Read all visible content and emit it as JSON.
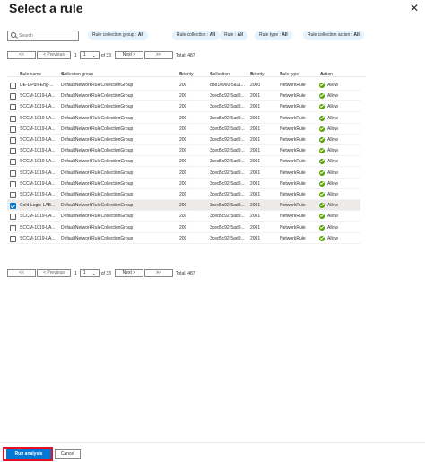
{
  "panel": {
    "title": "Select a rule"
  },
  "search": {
    "placeholder": "Search",
    "value": ""
  },
  "filters": [
    {
      "label": "Rule collection group : ",
      "value": "All"
    },
    {
      "label": "Rule collection : ",
      "value": "All"
    },
    {
      "label": "Rule : ",
      "value": "All"
    },
    {
      "label": "Rule type : ",
      "value": "All"
    },
    {
      "label": "Rule collection action : ",
      "value": "All"
    }
  ],
  "pager": {
    "first": "<<",
    "prev": "< Previous",
    "page": "1",
    "of_label": "of 33",
    "next": "Next >",
    "last": ">>",
    "total": "Total: 487"
  },
  "table": {
    "columns": [
      "Rule name",
      "Collection group",
      "Priority",
      "Collection",
      "Priority",
      "Rule type",
      "Action"
    ],
    "rows": [
      {
        "selected": false,
        "name": "DE-DPun-Eng-...",
        "group": "DefaultNetworkRuleCollectionGroup",
        "priority": "200",
        "collection": "db810960-5a11...",
        "priority2": "2000",
        "type": "NetworkRule",
        "action": "Allow"
      },
      {
        "selected": false,
        "name": "SCCM-1019-LA...",
        "group": "DefaultNetworkRuleCollectionGroup",
        "priority": "200",
        "collection": "3ced5c92-5ad9...",
        "priority2": "2001",
        "type": "NetworkRule",
        "action": "Allow"
      },
      {
        "selected": false,
        "name": "SCCM-1019-LA...",
        "group": "DefaultNetworkRuleCollectionGroup",
        "priority": "200",
        "collection": "3ced5c92-5ad9...",
        "priority2": "2001",
        "type": "NetworkRule",
        "action": "Allow"
      },
      {
        "selected": false,
        "name": "SCCM-1019-LA...",
        "group": "DefaultNetworkRuleCollectionGroup",
        "priority": "200",
        "collection": "3ced5c92-5ad9...",
        "priority2": "2001",
        "type": "NetworkRule",
        "action": "Allow"
      },
      {
        "selected": false,
        "name": "SCCM-1019-LA...",
        "group": "DefaultNetworkRuleCollectionGroup",
        "priority": "200",
        "collection": "3ced5c92-5ad9...",
        "priority2": "2001",
        "type": "NetworkRule",
        "action": "Allow"
      },
      {
        "selected": false,
        "name": "SCCM-1019-LA...",
        "group": "DefaultNetworkRuleCollectionGroup",
        "priority": "200",
        "collection": "3ced5c92-5ad9...",
        "priority2": "2001",
        "type": "NetworkRule",
        "action": "Allow"
      },
      {
        "selected": false,
        "name": "SCCM-1019-LA...",
        "group": "DefaultNetworkRuleCollectionGroup",
        "priority": "200",
        "collection": "3ced5c92-5ad9...",
        "priority2": "2001",
        "type": "NetworkRule",
        "action": "Allow"
      },
      {
        "selected": false,
        "name": "SCCM-1019-LA...",
        "group": "DefaultNetworkRuleCollectionGroup",
        "priority": "200",
        "collection": "3ced5c92-5ad9...",
        "priority2": "2001",
        "type": "NetworkRule",
        "action": "Allow"
      },
      {
        "selected": false,
        "name": "SCCM-1019-LA...",
        "group": "DefaultNetworkRuleCollectionGroup",
        "priority": "200",
        "collection": "3ced5c92-5ad9...",
        "priority2": "2001",
        "type": "NetworkRule",
        "action": "Allow"
      },
      {
        "selected": false,
        "name": "SCCM-1019-LA...",
        "group": "DefaultNetworkRuleCollectionGroup",
        "priority": "200",
        "collection": "3ced5c92-5ad9...",
        "priority2": "2001",
        "type": "NetworkRule",
        "action": "Allow"
      },
      {
        "selected": false,
        "name": "SCCM-1019-LA...",
        "group": "DefaultNetworkRuleCollectionGroup",
        "priority": "200",
        "collection": "3ced5c92-5ad9...",
        "priority2": "2001",
        "type": "NetworkRule",
        "action": "Allow"
      },
      {
        "selected": true,
        "name": "Cold-Logic-LAB...",
        "group": "DefaultNetworkRuleCollectionGroup",
        "priority": "200",
        "collection": "3ced5c92-5ad9...",
        "priority2": "2001",
        "type": "NetworkRule",
        "action": "Allow"
      },
      {
        "selected": false,
        "name": "SCCM-1019-LA...",
        "group": "DefaultNetworkRuleCollectionGroup",
        "priority": "200",
        "collection": "3ced5c92-5ad9...",
        "priority2": "2001",
        "type": "NetworkRule",
        "action": "Allow"
      },
      {
        "selected": false,
        "name": "SCCM-1019-LA...",
        "group": "DefaultNetworkRuleCollectionGroup",
        "priority": "200",
        "collection": "3ced5c92-5ad9...",
        "priority2": "2001",
        "type": "NetworkRule",
        "action": "Allow"
      },
      {
        "selected": false,
        "name": "SCCM-1019-LA...",
        "group": "DefaultNetworkRuleCollectionGroup",
        "priority": "200",
        "collection": "3ced5c92-5ad9...",
        "priority2": "2001",
        "type": "NetworkRule",
        "action": "Allow"
      }
    ]
  },
  "footer": {
    "run_label": "Run analysis",
    "cancel_label": "Cancel"
  },
  "colors": {
    "primary": "#0078d4",
    "allow": "#57a300",
    "pill_bg": "#e6f2fb",
    "highlight": "#e81123"
  },
  "icons": {
    "close": "close-icon",
    "search": "search-icon",
    "allow": "checkmark-circle-icon",
    "sort": "sort-icon"
  }
}
